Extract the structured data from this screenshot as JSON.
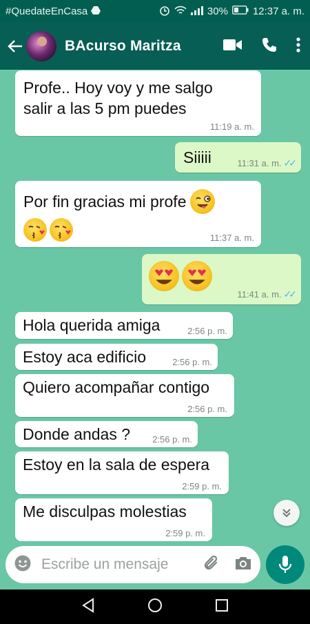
{
  "status_bar": {
    "hashtag": "#QuedateEnCasa",
    "battery": "30%",
    "time": "12:37 a. m."
  },
  "header": {
    "contact_name": "BAcurso Maritza"
  },
  "messages": [
    {
      "dir": "in",
      "lines": [
        "Profe.. Hoy voy y me salgo",
        "salir a las 5 pm puedes"
      ],
      "time": "11:19 a. m."
    },
    {
      "dir": "out",
      "text": "Siiiii",
      "time": "11:31 a. m."
    },
    {
      "dir": "in",
      "text": "Por fin gracias mi profe",
      "emojis": [
        "winking-tongue-emoji",
        "kissing-heart-emoji",
        "kissing-heart-emoji"
      ],
      "time": "11:37 a. m."
    },
    {
      "dir": "out",
      "emojis": [
        "heart-eyes-emoji",
        "heart-eyes-emoji"
      ],
      "time": "11:41 a. m."
    },
    {
      "dir": "in",
      "text": "Hola querida amiga",
      "time": "2:56 p. m."
    },
    {
      "dir": "in",
      "text": "Estoy aca edificio",
      "time": "2:56 p. m."
    },
    {
      "dir": "in",
      "text": "Quiero acompañar contigo",
      "time": "2:56 p. m."
    },
    {
      "dir": "in",
      "text": "Donde andas ?",
      "time": "2:56 p. m."
    },
    {
      "dir": "in",
      "text": "Estoy en la sala de espera",
      "time": "2:59 p. m."
    },
    {
      "dir": "in",
      "text": "Me disculpas molestias",
      "time": "2:59 p. m."
    }
  ],
  "composer": {
    "placeholder": "Escribe un mensaje"
  },
  "colors": {
    "header": "#075e54",
    "chat_background": "#6ac7a6",
    "outgoing_bubble": "#dcf8c6",
    "incoming_bubble": "#ffffff",
    "mic_button": "#00897b",
    "read_ticks": "#4fb6ec"
  }
}
